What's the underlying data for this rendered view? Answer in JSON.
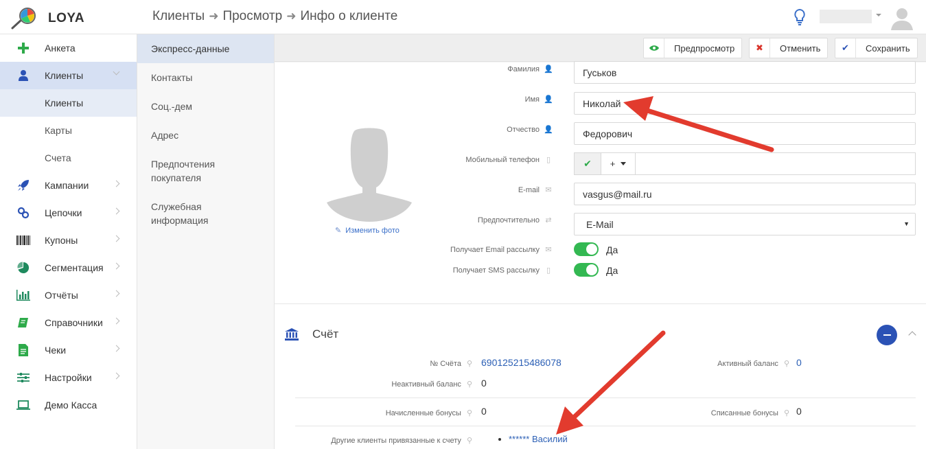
{
  "header": {
    "logo_text": "LOYA",
    "breadcrumb": [
      "Клиенты",
      "Просмотр",
      "Инфо о клиенте"
    ]
  },
  "sidebar": {
    "items": [
      {
        "label": "Анкета",
        "icon": "plus-icon"
      },
      {
        "label": "Клиенты",
        "icon": "user-icon"
      },
      {
        "label": "Клиенты"
      },
      {
        "label": "Карты"
      },
      {
        "label": "Счета"
      },
      {
        "label": "Кампании",
        "icon": "rocket-icon"
      },
      {
        "label": "Цепочки",
        "icon": "chain-icon"
      },
      {
        "label": "Купоны",
        "icon": "barcode-icon"
      },
      {
        "label": "Сегментация",
        "icon": "pie-icon"
      },
      {
        "label": "Отчёты",
        "icon": "bar-chart-icon"
      },
      {
        "label": "Справочники",
        "icon": "book-icon"
      },
      {
        "label": "Чеки",
        "icon": "receipt-icon"
      },
      {
        "label": "Настройки",
        "icon": "sliders-icon"
      },
      {
        "label": "Демо Касса",
        "icon": "laptop-icon"
      }
    ]
  },
  "subnav": {
    "items": [
      "Экспресс-данные",
      "Контакты",
      "Соц.-дем",
      "Адрес",
      "Предпочтения покупателя",
      "Служебная информация"
    ]
  },
  "toolbar": {
    "preview_label": "Предпросмотр",
    "cancel_label": "Отменить",
    "save_label": "Сохранить"
  },
  "profile": {
    "change_photo": "Изменить фото",
    "fields": {
      "last_name_label": "Фамилия",
      "last_name_value": "Гуськов",
      "first_name_label": "Имя",
      "first_name_value": "Николай",
      "middle_name_label": "Отчество",
      "middle_name_value": "Федорович",
      "phone_label": "Мобильный телефон",
      "phone_code": "+",
      "email_label": "E-mail",
      "email_value": "vasgus@mail.ru",
      "preferred_label": "Предпочтительно",
      "preferred_value": "E-Mail",
      "email_sub_label": "Получает Email рассылку",
      "email_sub_value": "Да",
      "email_sub_on": true,
      "sms_sub_label": "Получает SMS рассылку",
      "sms_sub_value": "Да",
      "sms_sub_on": true
    }
  },
  "account": {
    "title": "Счёт",
    "number_label": "№ Счёта",
    "number_value": "690125215486078",
    "active_balance_label": "Активный баланс",
    "active_balance_value": "0",
    "inactive_balance_label": "Неактивный баланс",
    "inactive_balance_value": "0",
    "accrued_label": "Начисленные бонусы",
    "accrued_value": "0",
    "written_off_label": "Списанные бонусы",
    "written_off_value": "0",
    "linked_label": "Другие клиенты привязанные к счету",
    "linked_clients": [
      "****** Василий"
    ]
  },
  "colors": {
    "accent": "#2b52b5",
    "toggle_on": "#33b852",
    "arrow": "#e23b2e"
  }
}
